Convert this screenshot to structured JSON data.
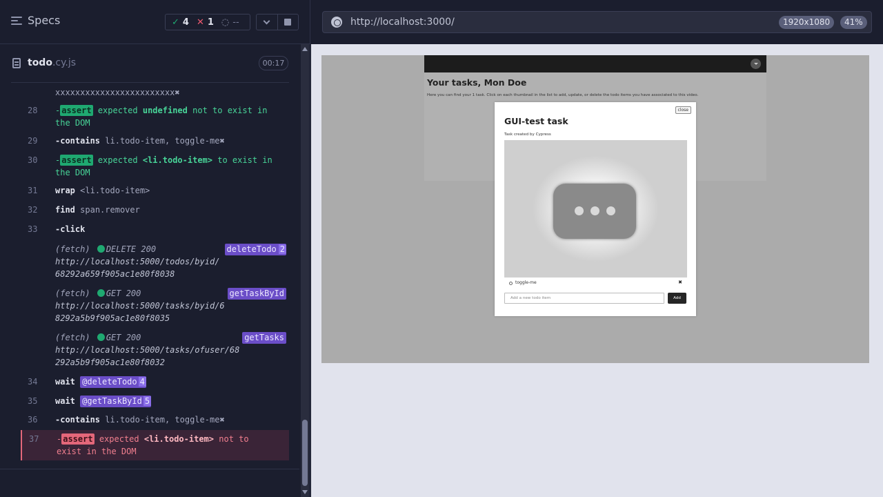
{
  "reporter": {
    "specs_label": "Specs",
    "stats": {
      "passed": "4",
      "failed": "1",
      "pending": "--"
    },
    "spec": {
      "name": "todo",
      "ext": ".cy.js",
      "duration": "00:17"
    }
  },
  "log": {
    "top_fragment": "xxxxxxxxxxxxxxxxxxxxxxxx",
    "r28": {
      "num": "28",
      "prefix": "-",
      "badge": "assert",
      "a": "expected",
      "b": "undefined",
      "c": "not to exist in",
      "d": "the DOM"
    },
    "r29": {
      "num": "29",
      "cmd": "-contains",
      "arg": "li.todo-item, toggle-me"
    },
    "r30": {
      "num": "30",
      "prefix": "-",
      "badge": "assert",
      "a": "expected",
      "b": "<li.todo-item>",
      "c": "to exist in",
      "d": "the DOM"
    },
    "r31": {
      "num": "31",
      "cmd": "wrap",
      "arg": "<li.todo-item>"
    },
    "r32": {
      "num": "32",
      "cmd": "find",
      "arg": "span.remover"
    },
    "r33": {
      "num": "33",
      "cmd": "-click"
    },
    "f1": {
      "type": "(fetch)",
      "method": "DELETE 200",
      "url1": "http://localhost:5000/todos/byid/",
      "url2": "68292a659f905ac1e80f8038",
      "alias": "deleteTodo",
      "count": "2"
    },
    "f2": {
      "type": "(fetch)",
      "method": "GET 200",
      "url1": "http://localhost:5000/tasks/byid/6",
      "url2": "8292a5b9f905ac1e80f8035",
      "alias": "getTaskById"
    },
    "f3": {
      "type": "(fetch)",
      "method": "GET 200",
      "url1": "http://localhost:5000/tasks/ofuser/68",
      "url2": "292a5b9f905ac1e80f8032",
      "alias": "getTasks"
    },
    "r34": {
      "num": "34",
      "cmd": "wait",
      "alias": "@deleteTodo",
      "count": "4"
    },
    "r35": {
      "num": "35",
      "cmd": "wait",
      "alias": "@getTaskById",
      "count": "5"
    },
    "r36": {
      "num": "36",
      "cmd": "-contains",
      "arg": "li.todo-item, toggle-me"
    },
    "r37": {
      "num": "37",
      "prefix": "-",
      "badge": "assert",
      "a": "expected",
      "b": "<li.todo-item>",
      "c": "not to",
      "d": "exist in the DOM"
    }
  },
  "aut": {
    "url": "http://localhost:3000/",
    "viewport": "1920x1080",
    "zoom": "41%",
    "page_title": "Your tasks, Mon Doe",
    "page_desc": "Here you can find your 1 task. Click on each thumbnail in the list to add, update, or delete the todo items you have associated to this video.",
    "modal": {
      "close": "close",
      "title": "GUI-test task",
      "subtitle": "Task created by Cypress",
      "todo_label": "toggle-me",
      "remover": "✖",
      "input_placeholder": "Add a new todo item",
      "add_label": "Add"
    }
  },
  "colors": {
    "pass": "#1fa971",
    "fail": "#e4677a",
    "alias": "#6b4ec8"
  }
}
